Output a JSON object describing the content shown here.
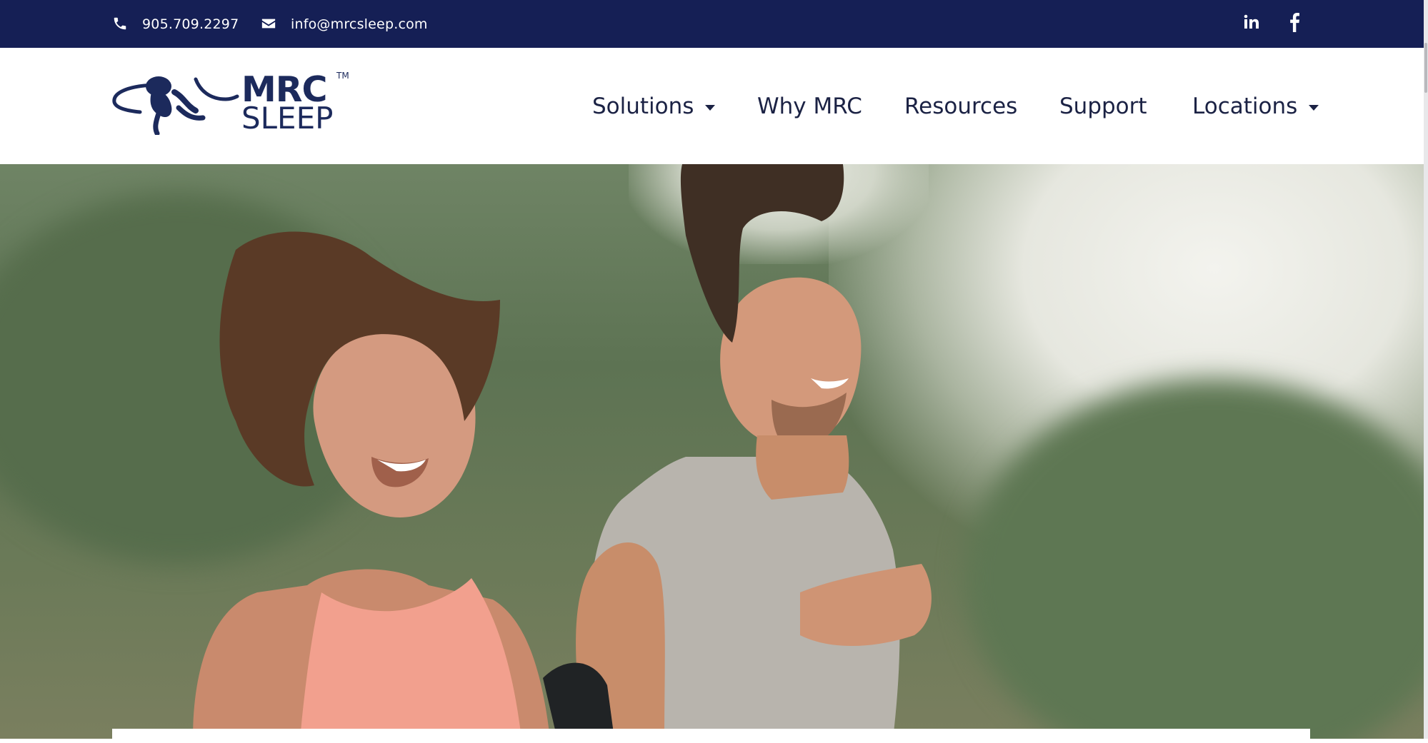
{
  "topbar": {
    "phone": "905.709.2297",
    "email": "info@mrcsleep.com",
    "icons": [
      "phone-icon",
      "envelope-icon",
      "linkedin-icon",
      "facebook-icon"
    ]
  },
  "logo": {
    "line1": "MRC",
    "line2": "SLEEP",
    "tm": "TM"
  },
  "nav": {
    "items": [
      {
        "label": "Solutions",
        "dropdown": true
      },
      {
        "label": "Why MRC",
        "dropdown": false
      },
      {
        "label": "Resources",
        "dropdown": false
      },
      {
        "label": "Support",
        "dropdown": false
      },
      {
        "label": "Locations",
        "dropdown": true
      }
    ]
  },
  "colors": {
    "topbar": "#151f55",
    "brand": "#1c2a5c",
    "nav_text": "#1b2244"
  }
}
